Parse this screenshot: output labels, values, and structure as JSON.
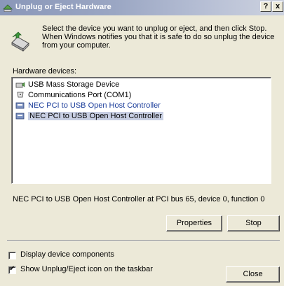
{
  "window": {
    "title": "Unplug or Eject Hardware",
    "help_button": "?",
    "close_button": "x"
  },
  "instructions": "Select the device you want to unplug or eject, and then click Stop. When Windows notifies you that it is safe to do so unplug the device from your computer.",
  "hardware_label": "Hardware devices:",
  "devices": [
    {
      "label": "USB Mass Storage Device",
      "icon": "usb-device-icon"
    },
    {
      "label": "Communications Port (COM1)",
      "icon": "port-icon"
    },
    {
      "label": "NEC PCI to USB Open Host Controller",
      "icon": "usb-controller-icon"
    },
    {
      "label": "NEC PCI to USB Open Host Controller",
      "icon": "usb-controller-icon"
    }
  ],
  "status_text": "NEC PCI to USB Open Host Controller at PCI bus 65, device 0, function 0",
  "buttons": {
    "properties": "Properties",
    "stop": "Stop",
    "close": "Close"
  },
  "checkboxes": {
    "display_components": {
      "label": "Display device components",
      "checked": false
    },
    "show_icon": {
      "label": "Show Unplug/Eject icon on the taskbar",
      "checked": true
    }
  },
  "colors": {
    "titlebar": "#8a97b9",
    "dialog_bg": "#ece9d8",
    "hover_text": "#1a3c9a",
    "selection_bg": "#c8cfe3"
  }
}
